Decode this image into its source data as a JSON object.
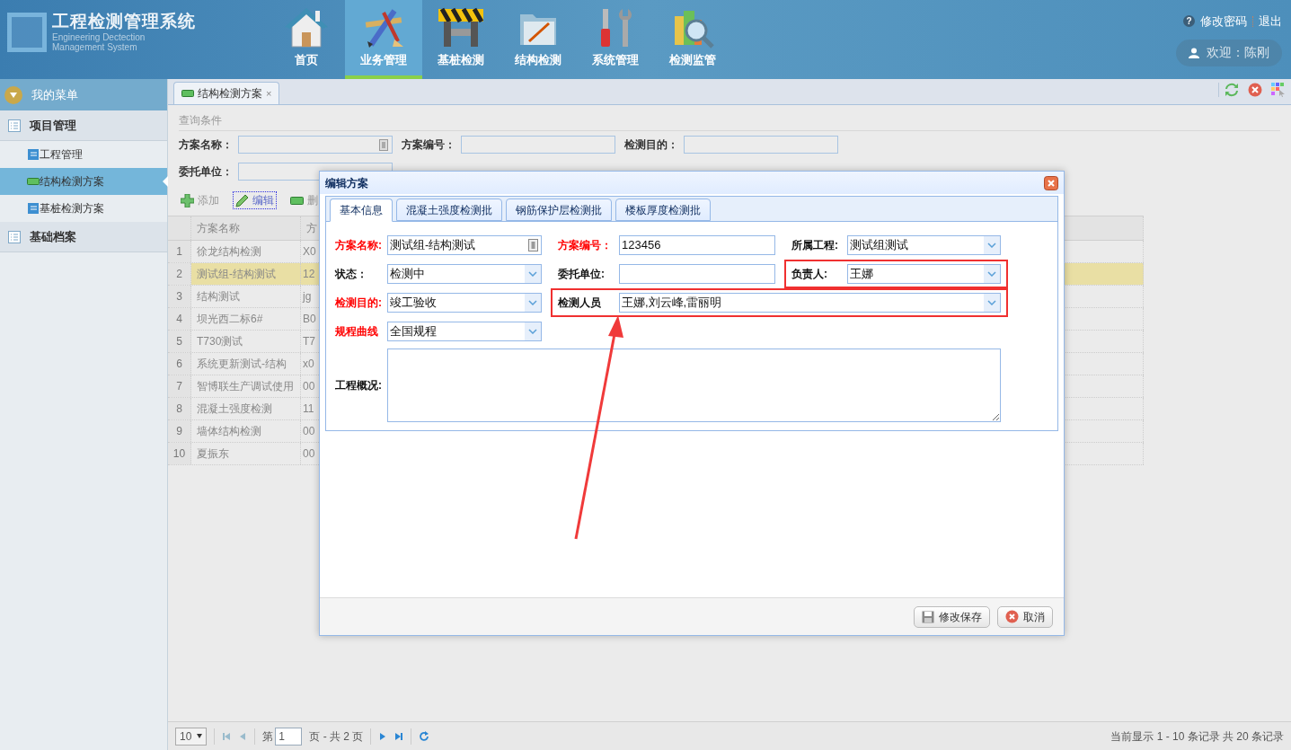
{
  "header": {
    "title": "工程检测管理系统",
    "subtitle": [
      "Engineering Dectection",
      "Management System"
    ],
    "nav": [
      {
        "label": "首页",
        "kind": "home",
        "selected": false
      },
      {
        "label": "业务管理",
        "kind": "business",
        "selected": true
      },
      {
        "label": "基桩检测",
        "kind": "pile",
        "selected": false
      },
      {
        "label": "结构检测",
        "kind": "structure",
        "selected": false
      },
      {
        "label": "系统管理",
        "kind": "system",
        "selected": false
      },
      {
        "label": "检测监管",
        "kind": "supervise",
        "selected": false
      }
    ],
    "help_glyph": "?",
    "links": [
      "修改密码",
      "退出"
    ],
    "welcome": "欢迎：陈刚"
  },
  "sidebar": {
    "title": "我的菜单",
    "groups": [
      {
        "label": "项目管理",
        "children": [
          {
            "label": "工程管理",
            "kind": "doc",
            "selected": false
          },
          {
            "label": "结构检测方案",
            "kind": "bar",
            "selected": true
          },
          {
            "label": "基桩检测方案",
            "kind": "doc",
            "selected": false
          }
        ]
      },
      {
        "label": "基础档案"
      }
    ]
  },
  "tabs": [
    {
      "label": "结构检测方案",
      "close": "×",
      "selected": true
    }
  ],
  "query": {
    "title": "查询条件",
    "rows": [
      [
        {
          "label": "方案名称：",
          "kind": "picker"
        },
        {
          "label": "方案编号：",
          "kind": "text"
        },
        {
          "label": "检测目的：",
          "kind": "text"
        }
      ],
      [
        {
          "label": "委托单位：",
          "kind": "text"
        }
      ]
    ]
  },
  "toolbar": [
    {
      "label": "添加",
      "kind": "add",
      "focused": false
    },
    {
      "label": "编辑",
      "kind": "edit",
      "focused": true
    },
    {
      "label": "删",
      "kind": "delete",
      "focused": false
    }
  ],
  "grid": {
    "columns": [
      "方案名称",
      "方"
    ],
    "rows": [
      {
        "index": "1",
        "cells": [
          "徐龙结构检测",
          "X0"
        ],
        "selected": false
      },
      {
        "index": "2",
        "cells": [
          "测试组-结构测试",
          "12"
        ],
        "selected": true
      },
      {
        "index": "3",
        "cells": [
          "结构测试",
          "jg"
        ],
        "selected": false
      },
      {
        "index": "4",
        "cells": [
          "坝光西二标6#",
          "B0"
        ],
        "selected": false
      },
      {
        "index": "5",
        "cells": [
          "T730测试",
          "T7"
        ],
        "selected": false
      },
      {
        "index": "6",
        "cells": [
          "系统更新测试-结构",
          "x0"
        ],
        "selected": false
      },
      {
        "index": "7",
        "cells": [
          "智博联生产调试使用",
          "00"
        ],
        "selected": false
      },
      {
        "index": "8",
        "cells": [
          "混凝土强度检测",
          "11"
        ],
        "selected": false
      },
      {
        "index": "9",
        "cells": [
          "墙体结构检测",
          "00"
        ],
        "selected": false
      },
      {
        "index": "10",
        "cells": [
          "夏振东",
          "00"
        ],
        "selected": false
      }
    ]
  },
  "pager": {
    "page_size": "10",
    "page_prefix": "第",
    "page": "1",
    "page_suffix": "页 - 共 2 页",
    "summary": "当前显示 1 - 10 条记录 共 20 条记录"
  },
  "dialog": {
    "title": "编辑方案",
    "tabs": [
      {
        "label": "基本信息",
        "selected": true
      },
      {
        "label": "混凝土强度检测批",
        "selected": false
      },
      {
        "label": "钢筋保护层检测批",
        "selected": false
      },
      {
        "label": "楼板厚度检测批",
        "selected": false
      }
    ],
    "rows": [
      [
        {
          "label": "方案名称:",
          "required": true,
          "kind": "picker",
          "value": "测试组-结构测试",
          "highlighted": false
        },
        {
          "label": "方案编号：",
          "required": true,
          "kind": "text",
          "value": "123456",
          "highlighted": false
        },
        {
          "label": "所属工程:",
          "required": false,
          "kind": "combo",
          "value": "测试组测试",
          "highlighted": false
        }
      ],
      [
        {
          "label": "状态：",
          "required": false,
          "kind": "combo",
          "value": "检测中",
          "highlighted": false
        },
        {
          "label": "委托单位:",
          "required": false,
          "kind": "text",
          "highlighted": false
        },
        {
          "label": "负责人:",
          "required": false,
          "kind": "combo",
          "value": "王娜",
          "highlighted": true
        }
      ],
      [
        {
          "label": "检测目的:",
          "required": true,
          "kind": "combo",
          "value": "竣工验收",
          "highlighted": false
        },
        {
          "label": "检测人员",
          "required": false,
          "kind": "combo",
          "value": "王娜,刘云峰,雷丽明",
          "highlighted": true
        }
      ],
      [
        {
          "label": "规程曲线",
          "required": true,
          "kind": "combo",
          "value": "全国规程",
          "highlighted": false
        }
      ]
    ],
    "overview_label": "工程概况:",
    "buttons": [
      {
        "label": "修改保存",
        "kind": "save"
      },
      {
        "label": "取消",
        "kind": "cancel"
      }
    ]
  }
}
